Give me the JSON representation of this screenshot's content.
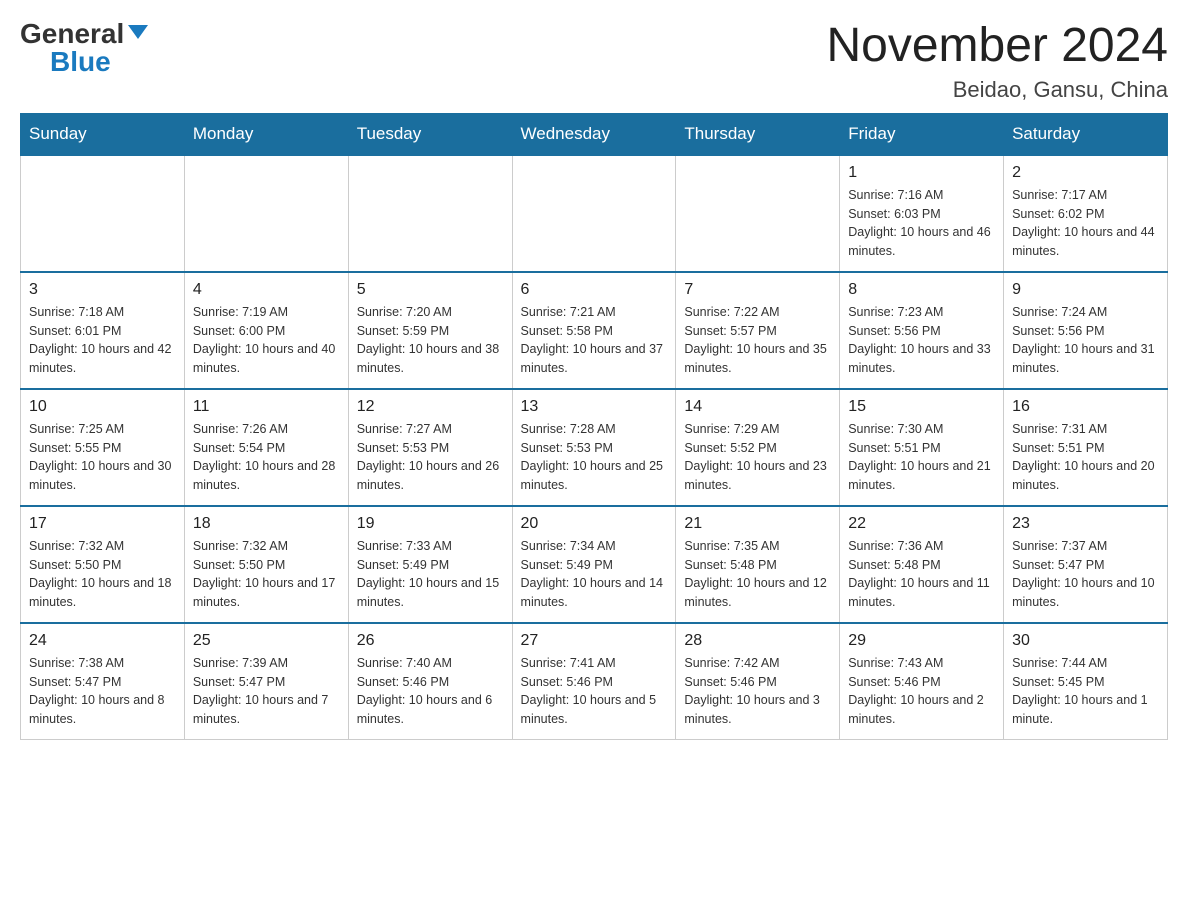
{
  "header": {
    "logo_general": "General",
    "logo_blue": "Blue",
    "month_year": "November 2024",
    "location": "Beidao, Gansu, China"
  },
  "weekdays": [
    "Sunday",
    "Monday",
    "Tuesday",
    "Wednesday",
    "Thursday",
    "Friday",
    "Saturday"
  ],
  "weeks": [
    [
      {
        "day": "",
        "info": ""
      },
      {
        "day": "",
        "info": ""
      },
      {
        "day": "",
        "info": ""
      },
      {
        "day": "",
        "info": ""
      },
      {
        "day": "",
        "info": ""
      },
      {
        "day": "1",
        "info": "Sunrise: 7:16 AM\nSunset: 6:03 PM\nDaylight: 10 hours and 46 minutes."
      },
      {
        "day": "2",
        "info": "Sunrise: 7:17 AM\nSunset: 6:02 PM\nDaylight: 10 hours and 44 minutes."
      }
    ],
    [
      {
        "day": "3",
        "info": "Sunrise: 7:18 AM\nSunset: 6:01 PM\nDaylight: 10 hours and 42 minutes."
      },
      {
        "day": "4",
        "info": "Sunrise: 7:19 AM\nSunset: 6:00 PM\nDaylight: 10 hours and 40 minutes."
      },
      {
        "day": "5",
        "info": "Sunrise: 7:20 AM\nSunset: 5:59 PM\nDaylight: 10 hours and 38 minutes."
      },
      {
        "day": "6",
        "info": "Sunrise: 7:21 AM\nSunset: 5:58 PM\nDaylight: 10 hours and 37 minutes."
      },
      {
        "day": "7",
        "info": "Sunrise: 7:22 AM\nSunset: 5:57 PM\nDaylight: 10 hours and 35 minutes."
      },
      {
        "day": "8",
        "info": "Sunrise: 7:23 AM\nSunset: 5:56 PM\nDaylight: 10 hours and 33 minutes."
      },
      {
        "day": "9",
        "info": "Sunrise: 7:24 AM\nSunset: 5:56 PM\nDaylight: 10 hours and 31 minutes."
      }
    ],
    [
      {
        "day": "10",
        "info": "Sunrise: 7:25 AM\nSunset: 5:55 PM\nDaylight: 10 hours and 30 minutes."
      },
      {
        "day": "11",
        "info": "Sunrise: 7:26 AM\nSunset: 5:54 PM\nDaylight: 10 hours and 28 minutes."
      },
      {
        "day": "12",
        "info": "Sunrise: 7:27 AM\nSunset: 5:53 PM\nDaylight: 10 hours and 26 minutes."
      },
      {
        "day": "13",
        "info": "Sunrise: 7:28 AM\nSunset: 5:53 PM\nDaylight: 10 hours and 25 minutes."
      },
      {
        "day": "14",
        "info": "Sunrise: 7:29 AM\nSunset: 5:52 PM\nDaylight: 10 hours and 23 minutes."
      },
      {
        "day": "15",
        "info": "Sunrise: 7:30 AM\nSunset: 5:51 PM\nDaylight: 10 hours and 21 minutes."
      },
      {
        "day": "16",
        "info": "Sunrise: 7:31 AM\nSunset: 5:51 PM\nDaylight: 10 hours and 20 minutes."
      }
    ],
    [
      {
        "day": "17",
        "info": "Sunrise: 7:32 AM\nSunset: 5:50 PM\nDaylight: 10 hours and 18 minutes."
      },
      {
        "day": "18",
        "info": "Sunrise: 7:32 AM\nSunset: 5:50 PM\nDaylight: 10 hours and 17 minutes."
      },
      {
        "day": "19",
        "info": "Sunrise: 7:33 AM\nSunset: 5:49 PM\nDaylight: 10 hours and 15 minutes."
      },
      {
        "day": "20",
        "info": "Sunrise: 7:34 AM\nSunset: 5:49 PM\nDaylight: 10 hours and 14 minutes."
      },
      {
        "day": "21",
        "info": "Sunrise: 7:35 AM\nSunset: 5:48 PM\nDaylight: 10 hours and 12 minutes."
      },
      {
        "day": "22",
        "info": "Sunrise: 7:36 AM\nSunset: 5:48 PM\nDaylight: 10 hours and 11 minutes."
      },
      {
        "day": "23",
        "info": "Sunrise: 7:37 AM\nSunset: 5:47 PM\nDaylight: 10 hours and 10 minutes."
      }
    ],
    [
      {
        "day": "24",
        "info": "Sunrise: 7:38 AM\nSunset: 5:47 PM\nDaylight: 10 hours and 8 minutes."
      },
      {
        "day": "25",
        "info": "Sunrise: 7:39 AM\nSunset: 5:47 PM\nDaylight: 10 hours and 7 minutes."
      },
      {
        "day": "26",
        "info": "Sunrise: 7:40 AM\nSunset: 5:46 PM\nDaylight: 10 hours and 6 minutes."
      },
      {
        "day": "27",
        "info": "Sunrise: 7:41 AM\nSunset: 5:46 PM\nDaylight: 10 hours and 5 minutes."
      },
      {
        "day": "28",
        "info": "Sunrise: 7:42 AM\nSunset: 5:46 PM\nDaylight: 10 hours and 3 minutes."
      },
      {
        "day": "29",
        "info": "Sunrise: 7:43 AM\nSunset: 5:46 PM\nDaylight: 10 hours and 2 minutes."
      },
      {
        "day": "30",
        "info": "Sunrise: 7:44 AM\nSunset: 5:45 PM\nDaylight: 10 hours and 1 minute."
      }
    ]
  ]
}
